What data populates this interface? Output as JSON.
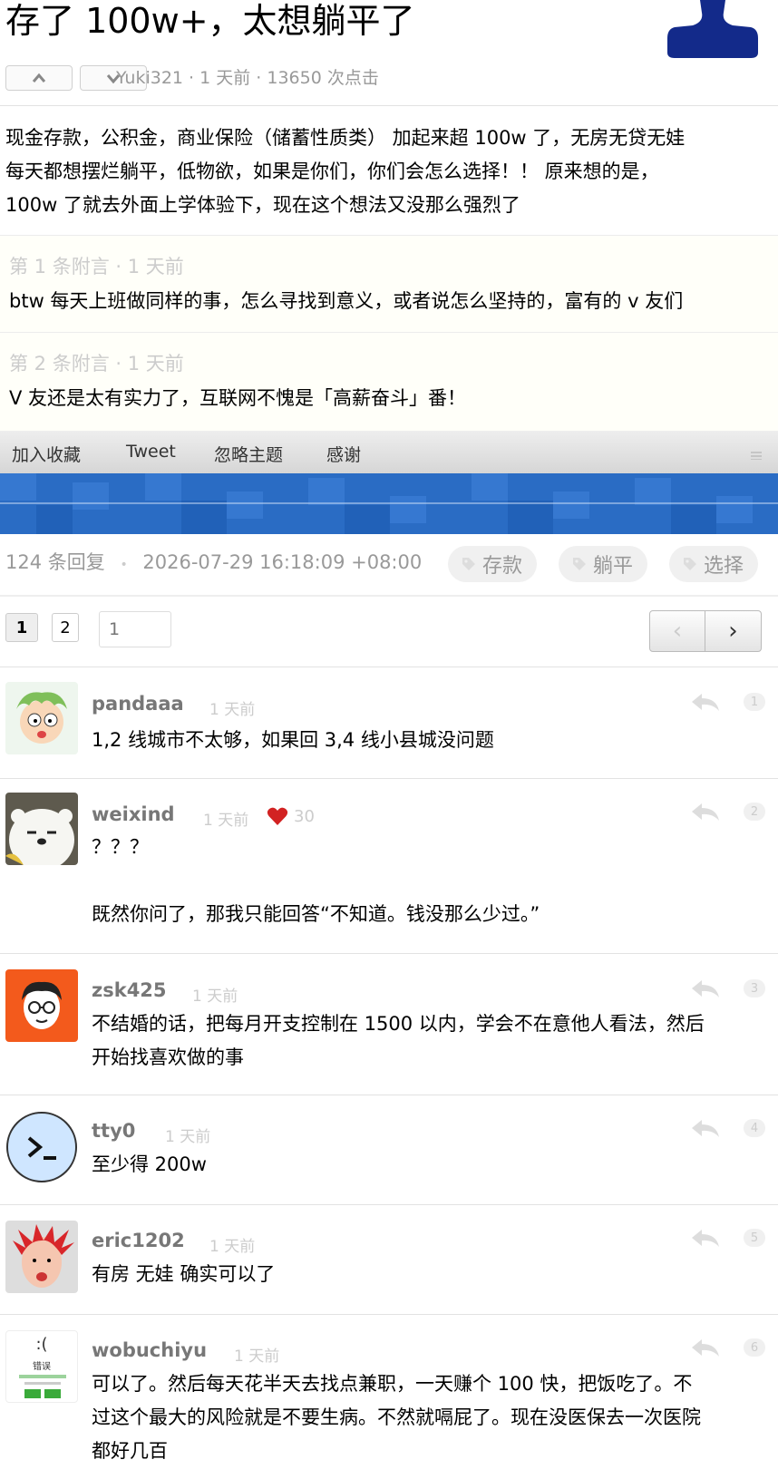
{
  "topic": {
    "title": "存了 100w+，太想躺平了",
    "meta": "Yuki321 · 1 天前 · 13650 次点击",
    "content": [
      "现金存款，公积金，商业保险（储蓄性质类） 加起来超 100w 了，无房无贷无娃",
      "每天都想摆烂躺平，低物欲，如果是你们，你们会怎么选择！！ 原来想的是，",
      "100w 了就去外面上学体验下，现在这个想法又没那么强烈了"
    ],
    "appends": [
      {
        "head": "第 1 条附言 · 1 天前",
        "body": "btw 每天上班做同样的事，怎么寻找到意义，或者说怎么坚持的，富有的 v 友们"
      },
      {
        "head": "第 2 条附言 · 1 天前",
        "body": "V 友还是太有实力了，互联网不愧是「高薪奋斗」番！"
      }
    ]
  },
  "toolbar": {
    "fav": "加入收藏",
    "tweet": "Tweet",
    "ignore": "忽略主题",
    "thank": "感谢"
  },
  "reply_info": {
    "count": "124 条回复",
    "sep": "•",
    "time": "2026-07-29 16:18:09 +08:00"
  },
  "tags": [
    "存款",
    "躺平",
    "选择"
  ],
  "pagination": {
    "pages": [
      "1",
      "2"
    ],
    "jump_placeholder": "1",
    "prev": "‹",
    "next": "›"
  },
  "replies": [
    {
      "user": "pandaaa",
      "ago": "1 天前",
      "floor": "1",
      "lines": [
        "1,2 线城市不太够，如果回 3,4 线小县城没问题"
      ]
    },
    {
      "user": "weixind",
      "ago": "1 天前",
      "likes": "30",
      "floor": "2",
      "lines": [
        "？？？",
        "",
        "既然你问了，那我只能回答“不知道。钱没那么少过。”"
      ]
    },
    {
      "user": "zsk425",
      "ago": "1 天前",
      "floor": "3",
      "lines": [
        "不结婚的话，把每月开支控制在 1500 以内，学会不在意他人看法，然后",
        "开始找喜欢做的事"
      ]
    },
    {
      "user": "tty0",
      "ago": "1 天前",
      "floor": "4",
      "lines": [
        "至少得 200w"
      ]
    },
    {
      "user": "eric1202",
      "ago": "1 天前",
      "floor": "5",
      "lines": [
        "有房 无娃 确实可以了"
      ]
    },
    {
      "user": "wobuchiyu",
      "ago": "1 天前",
      "floor": "6",
      "lines": [
        "可以了。然后每天花半天去找点兼职，一天赚个 100 快，把饭吃了。不",
        "过这个最大的风险就是不要生病。不然就嗝屁了。现在没医保去一次医院",
        "都好几百"
      ]
    }
  ],
  "wobuchiyu_avatar_text": {
    "face": ":(",
    "word": "错误"
  },
  "colors": {
    "banner": "#2a6cc4",
    "heart": "#d22222",
    "muted": "#999999",
    "subtle_bg": "#fffff9"
  }
}
